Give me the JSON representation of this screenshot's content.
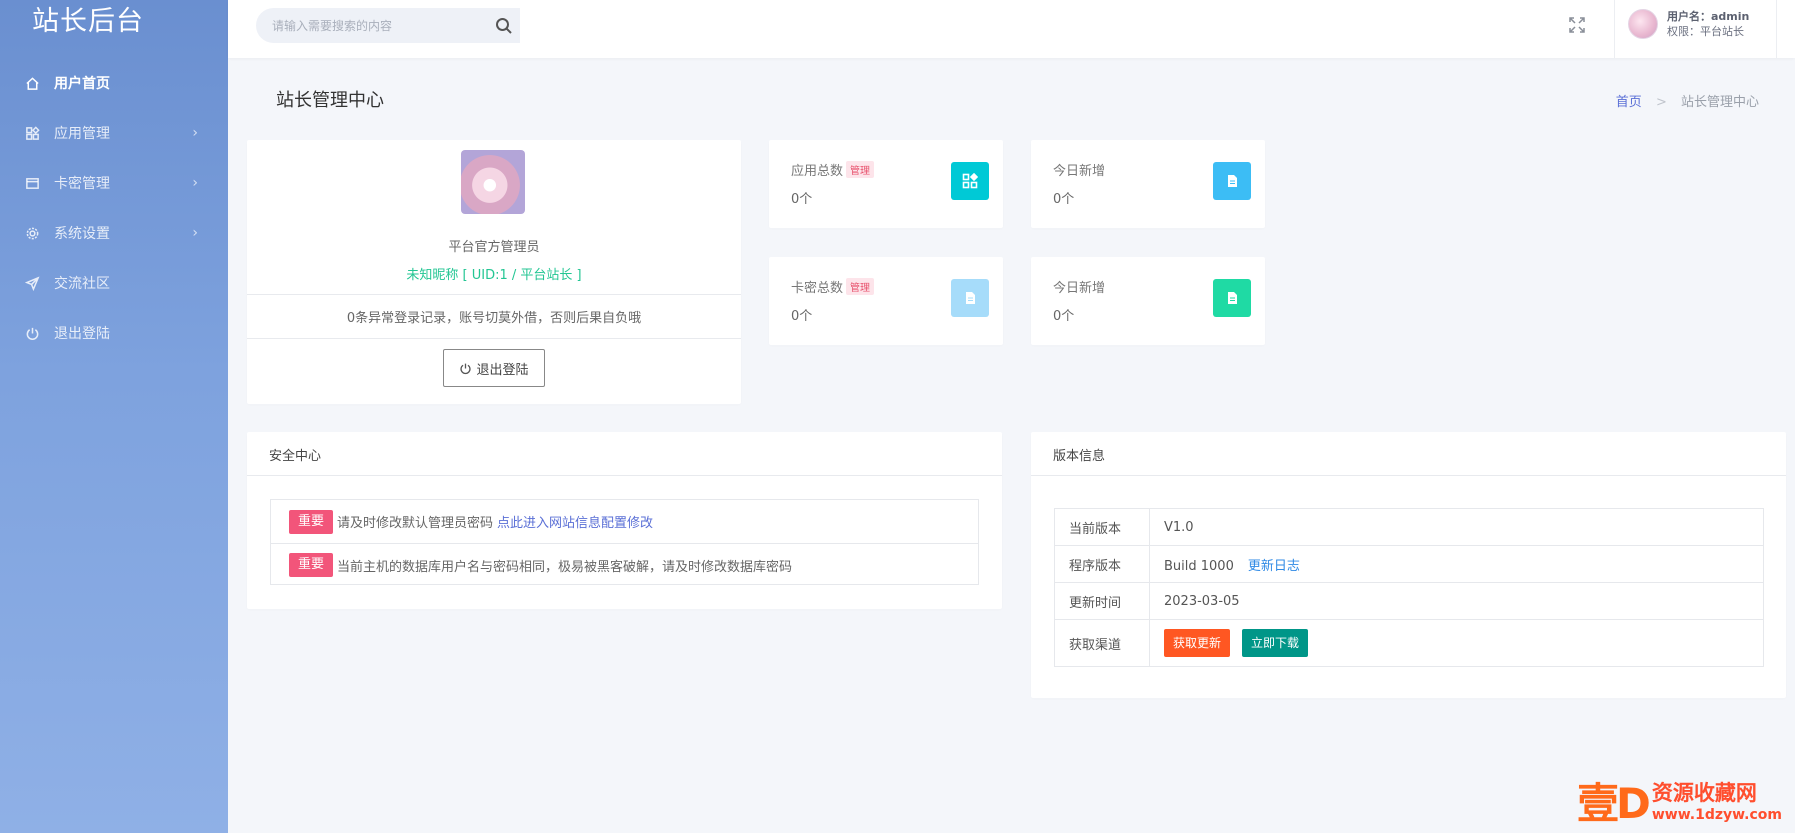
{
  "brand": "站长后台",
  "sidebar": {
    "items": [
      {
        "label": "用户首页",
        "icon": "home-icon"
      },
      {
        "label": "应用管理",
        "icon": "apps-icon"
      },
      {
        "label": "卡密管理",
        "icon": "card-icon"
      },
      {
        "label": "系统设置",
        "icon": "gear-icon"
      },
      {
        "label": "交流社区",
        "icon": "send-icon"
      },
      {
        "label": "退出登陆",
        "icon": "power-icon"
      }
    ],
    "arrow": "›"
  },
  "header": {
    "search_placeholder": "请输入需要搜索的内容",
    "user_label": "用户名：admin",
    "role_label": "权限：平台站长"
  },
  "page": {
    "title": "站长管理中心",
    "crumb_home": "首页",
    "crumb_sep": ">",
    "crumb_current": "站长管理中心"
  },
  "profile": {
    "role": "平台官方管理员",
    "nick": "未知昵称 [ UID:1 / 平台站长 ]",
    "notice": "0条异常登录记录，账号切莫外借，否则后果自负哦",
    "logout_label": "退出登陆"
  },
  "stats": [
    {
      "label": "应用总数",
      "tag": "管理",
      "value": "0个",
      "icon": "apps-icon",
      "color": "#00c9d6"
    },
    {
      "label": "今日新增",
      "tag": "",
      "value": "0个",
      "icon": "document-icon",
      "color": "#3cbdf5"
    },
    {
      "label": "卡密总数",
      "tag": "管理",
      "value": "0个",
      "icon": "document-icon",
      "color": "#a6dcfa"
    },
    {
      "label": "今日新增",
      "tag": "",
      "value": "0个",
      "icon": "document-icon",
      "color": "#1fdaa4"
    }
  ],
  "security": {
    "title": "安全中心",
    "rows": [
      {
        "badge": "重要",
        "text": "请及时修改默认管理员密码",
        "link": "点此进入网站信息配置修改"
      },
      {
        "badge": "重要",
        "text": "当前主机的数据库用户名与密码相同，极易被黑客破解，请及时修改数据库密码",
        "link": ""
      }
    ]
  },
  "version": {
    "title": "版本信息",
    "rows": [
      {
        "key": "当前版本",
        "value": "V1.0"
      },
      {
        "key": "程序版本",
        "value": "Build 1000",
        "link": "更新日志"
      },
      {
        "key": "更新时间",
        "value": "2023-03-05"
      },
      {
        "key": "获取渠道",
        "btn_update": "获取更新",
        "btn_download": "立即下载"
      }
    ]
  },
  "watermark": {
    "logo": "壹D",
    "title": "资源收藏网",
    "url": "www.1dzyw.com"
  },
  "colors": {
    "accent": "#5a6fd6",
    "sidebar_top": "#6a8fd0",
    "sidebar_bottom": "#8fb0e6",
    "success": "#23c693",
    "danger": "#f2557a",
    "orange": "#ff5722",
    "teal": "#009688"
  }
}
